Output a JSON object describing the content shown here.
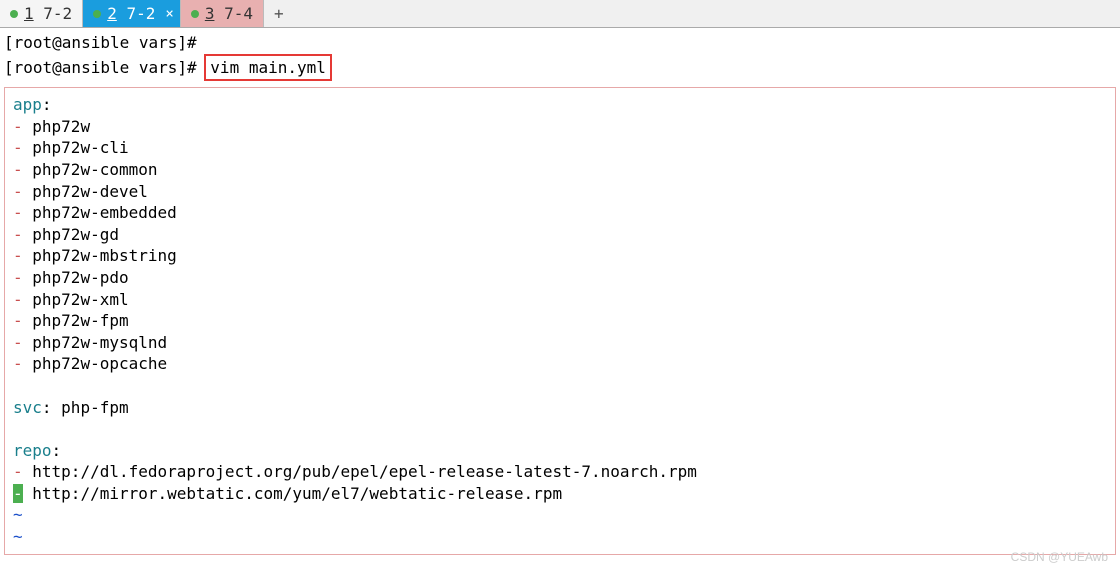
{
  "tabs": [
    {
      "num": "1",
      "label": "7-2"
    },
    {
      "num": "2",
      "label": "7-2"
    },
    {
      "num": "3",
      "label": "7-4"
    }
  ],
  "tab_close": "×",
  "tab_add": "+",
  "prompt1": "[root@ansible vars]#",
  "prompt2": "[root@ansible vars]#",
  "command": "vim main.yml",
  "yaml": {
    "key_app": "app",
    "colon": ":",
    "app_items": [
      "php72w",
      "php72w-cli",
      "php72w-common",
      "php72w-devel",
      "php72w-embedded",
      "php72w-gd",
      "php72w-mbstring",
      "php72w-pdo",
      "php72w-xml",
      "php72w-fpm",
      "php72w-mysqlnd",
      "php72w-opcache"
    ],
    "key_svc": "svc",
    "svc_value": "php-fpm",
    "key_repo": "repo",
    "repo_items": [
      "http://dl.fedoraproject.org/pub/epel/epel-release-latest-7.noarch.rpm",
      "http://mirror.webtatic.com/yum/el7/webtatic-release.rpm"
    ]
  },
  "dash": "-",
  "tilde": "~",
  "watermark": "CSDN @YUEAwb"
}
